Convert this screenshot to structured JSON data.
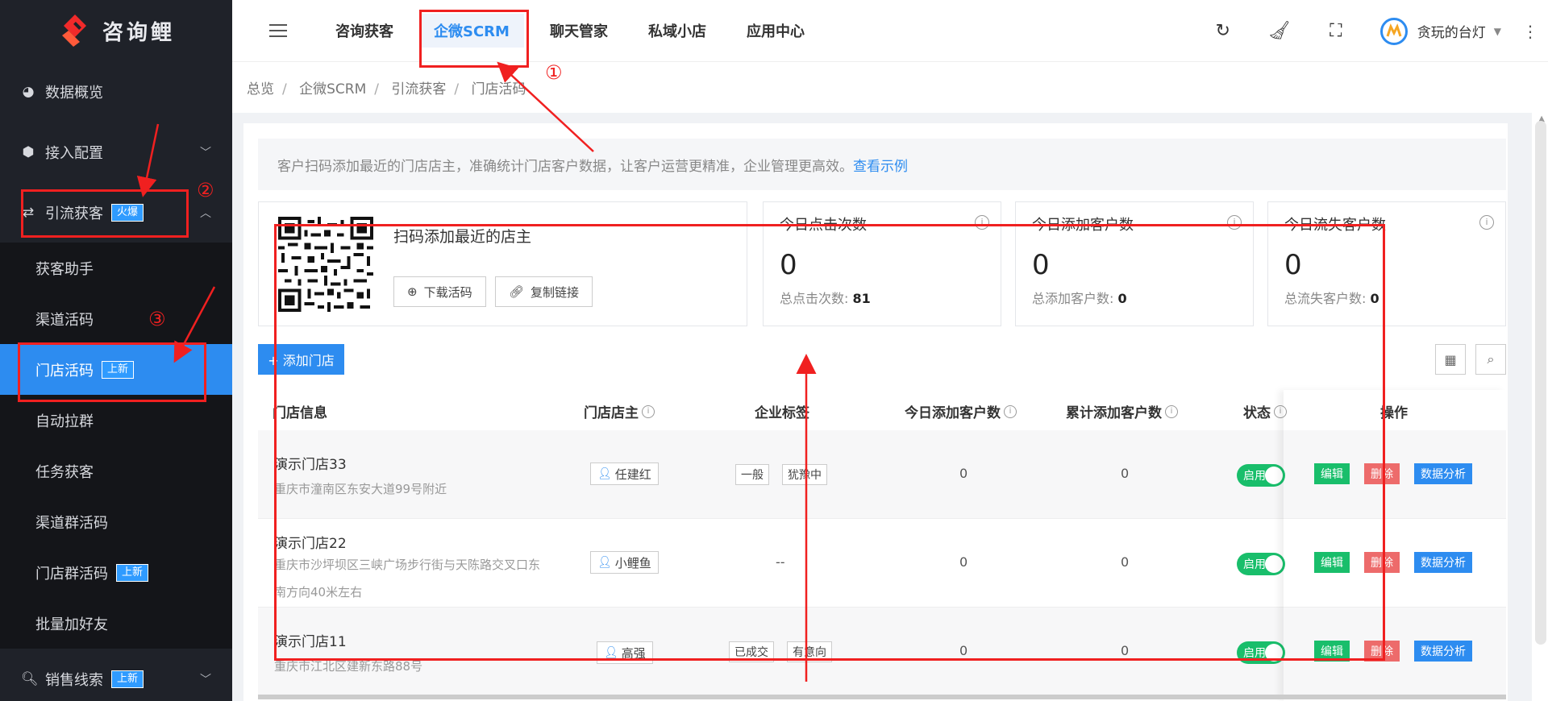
{
  "logo": {
    "text": "咨询鲤"
  },
  "sidebar": {
    "items": [
      {
        "label": "数据概览",
        "icon": "pie-chart-icon"
      },
      {
        "label": "接入配置",
        "icon": "cube-icon"
      },
      {
        "label": "引流获客",
        "icon": "refresh-arrows-icon",
        "badge": "火爆"
      }
    ],
    "submenu": [
      {
        "label": "获客助手"
      },
      {
        "label": "渠道活码"
      },
      {
        "label": "门店活码",
        "badge": "上新",
        "active": true
      },
      {
        "label": "自动拉群"
      },
      {
        "label": "任务获客"
      },
      {
        "label": "渠道群活码"
      },
      {
        "label": "门店群活码",
        "badge": "上新"
      },
      {
        "label": "批量加好友"
      }
    ],
    "bottom": {
      "label": "销售线索",
      "badge": "上新",
      "icon": "search-icon"
    }
  },
  "topnav": {
    "tabs": [
      "咨询获客",
      "企微SCRM",
      "聊天管家",
      "私域小店",
      "应用中心"
    ],
    "active_tab": "企微SCRM",
    "user_name": "贪玩的台灯"
  },
  "breadcrumb": [
    "总览",
    "企微SCRM",
    "引流获客",
    "门店活码"
  ],
  "notice": {
    "text": "客户扫码添加最近的门店店主，准确统计门店客户数据，让客户运营更精准，企业管理更高效。",
    "link": "查看示例"
  },
  "qr_card": {
    "title": "扫码添加最近的店主",
    "download": "下载活码",
    "copy": "复制链接"
  },
  "stats": [
    {
      "label": "今日点击次数",
      "value": "0",
      "sub_label": "总点击次数:",
      "sub_value": "81"
    },
    {
      "label": "今日添加客户数",
      "value": "0",
      "sub_label": "总添加客户数:",
      "sub_value": "0"
    },
    {
      "label": "今日流失客户数",
      "value": "0",
      "sub_label": "总流失客户数:",
      "sub_value": "0"
    }
  ],
  "add_store": "+ 添加门店",
  "table": {
    "headers": [
      "门店信息",
      "门店店主",
      "企业标签",
      "今日添加客户数",
      "累计添加客户数",
      "状态",
      "操作"
    ],
    "rows": [
      {
        "name": "演示门店33",
        "address": "重庆市潼南区东安大道99号附近",
        "owner": "任建红",
        "tags": [
          "一般",
          "犹豫中"
        ],
        "today": "0",
        "total": "0",
        "status": "启用"
      },
      {
        "name": "演示门店22",
        "address": "重庆市沙坪坝区三峡广场步行街与天陈路交叉口东南方向40米左右",
        "owner": "小鲤鱼",
        "tags": [],
        "tags_empty": "--",
        "today": "0",
        "total": "0",
        "status": "启用"
      },
      {
        "name": "演示门店11",
        "address": "重庆市江北区建新东路88号",
        "owner": "高强",
        "tags": [
          "已成交",
          "有意向"
        ],
        "today": "0",
        "total": "0",
        "status": "启用"
      }
    ],
    "ops": {
      "edit": "编辑",
      "delete": "删除",
      "analyze": "数据分析"
    }
  },
  "annotations": {
    "one": "①",
    "two": "②",
    "three": "③"
  },
  "colors": {
    "accent": "#2d8cf0",
    "sidebar_bg": "#1f2229",
    "annotation": "#f02020",
    "success": "#19be6b",
    "danger": "#ed6b6b"
  }
}
